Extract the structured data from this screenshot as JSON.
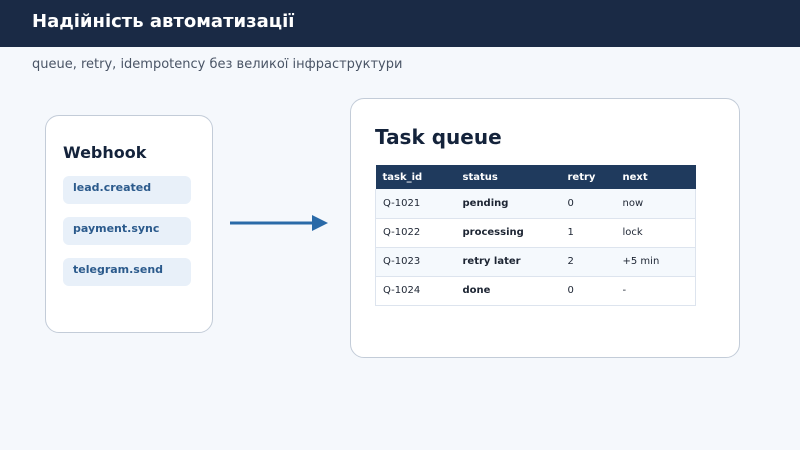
{
  "header": {
    "title": "Надійність автоматизації"
  },
  "subtitle": "queue, retry, idempotency без великої інфраструктури",
  "webhook": {
    "title": "Webhook",
    "events": [
      "lead.created",
      "payment.sync",
      "telegram.send"
    ]
  },
  "queue": {
    "title": "Task queue",
    "columns": [
      "task_id",
      "status",
      "retry",
      "next"
    ],
    "rows": [
      {
        "task_id": "Q-1021",
        "status": "pending",
        "retry": "0",
        "next": "now",
        "status_key": "pending"
      },
      {
        "task_id": "Q-1022",
        "status": "processing",
        "retry": "1",
        "next": "lock",
        "status_key": "processing"
      },
      {
        "task_id": "Q-1023",
        "status": "retry later",
        "retry": "2",
        "next": "+5 min",
        "status_key": "retry"
      },
      {
        "task_id": "Q-1024",
        "status": "done",
        "retry": "0",
        "next": "-",
        "status_key": "done"
      }
    ]
  },
  "colors": {
    "header_bg": "#1a2a45",
    "arrow": "#2a6aa8",
    "status_retry": "#b35d00",
    "status_done": "#2a7a4a"
  }
}
